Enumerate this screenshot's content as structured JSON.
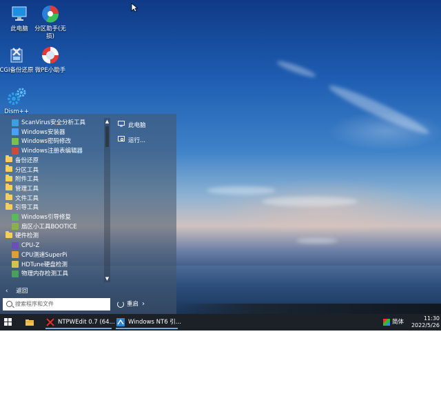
{
  "desktop": {
    "icons": [
      {
        "label": "此电脑",
        "icon": "computer-icon"
      },
      {
        "label": "分区助手(无损)",
        "icon": "partition-assistant-icon"
      },
      {
        "label": "CGI备份还原",
        "icon": "cgi-backup-icon"
      },
      {
        "label": "微PE小助手",
        "icon": "lifebuoy-icon"
      },
      {
        "label": "Dism++",
        "icon": "gears-icon"
      }
    ]
  },
  "start_menu": {
    "apps": [
      {
        "label": "ScanVirus安全分析工具",
        "kind": "app",
        "indent": true,
        "color": "#3aa0e0"
      },
      {
        "label": "Windows安装器",
        "kind": "app",
        "indent": true,
        "color": "#4aa0ff"
      },
      {
        "label": "Windows密码修改",
        "kind": "app",
        "indent": true,
        "color": "#7cbf4a"
      },
      {
        "label": "Windows注册表编辑器",
        "kind": "app",
        "indent": true,
        "color": "#d04a3a"
      },
      {
        "label": "备份还原",
        "kind": "folder",
        "indent": false
      },
      {
        "label": "分区工具",
        "kind": "folder",
        "indent": false
      },
      {
        "label": "附件工具",
        "kind": "folder",
        "indent": false
      },
      {
        "label": "管理工具",
        "kind": "folder",
        "indent": false
      },
      {
        "label": "文件工具",
        "kind": "folder",
        "indent": false
      },
      {
        "label": "引导工具",
        "kind": "folder",
        "indent": false
      },
      {
        "label": "Windows引导修复",
        "kind": "app",
        "indent": true,
        "color": "#5bb85b"
      },
      {
        "label": "扇区小工具BOOTICE",
        "kind": "app",
        "indent": true,
        "color": "#8ab04a"
      },
      {
        "label": "硬件检测",
        "kind": "folder",
        "indent": false
      },
      {
        "label": "CPU-Z",
        "kind": "app",
        "indent": true,
        "color": "#6b4fb8"
      },
      {
        "label": "CPU测速SuperPi",
        "kind": "app",
        "indent": true,
        "color": "#e0a030"
      },
      {
        "label": "HDTune硬盘检测",
        "kind": "app",
        "indent": true,
        "color": "#d8c050"
      },
      {
        "label": "物理内存检测工具",
        "kind": "app",
        "indent": true,
        "color": "#4aa05a"
      }
    ],
    "right": [
      {
        "label": "此电脑",
        "icon": "computer-icon"
      },
      {
        "label": "运行...",
        "icon": "run-icon"
      }
    ],
    "back_label": "返回",
    "search_placeholder": "搜索程序和文件",
    "power_label": "重启"
  },
  "taskbar": {
    "items": [
      {
        "label": "NTPWEdit 0.7 (64...",
        "icon": "ntpwedit-icon"
      },
      {
        "label": "Windows NT6 引...",
        "icon": "windows-nt6-icon"
      }
    ],
    "language": "简体",
    "time": "11:30",
    "date": "2022/5/26"
  }
}
